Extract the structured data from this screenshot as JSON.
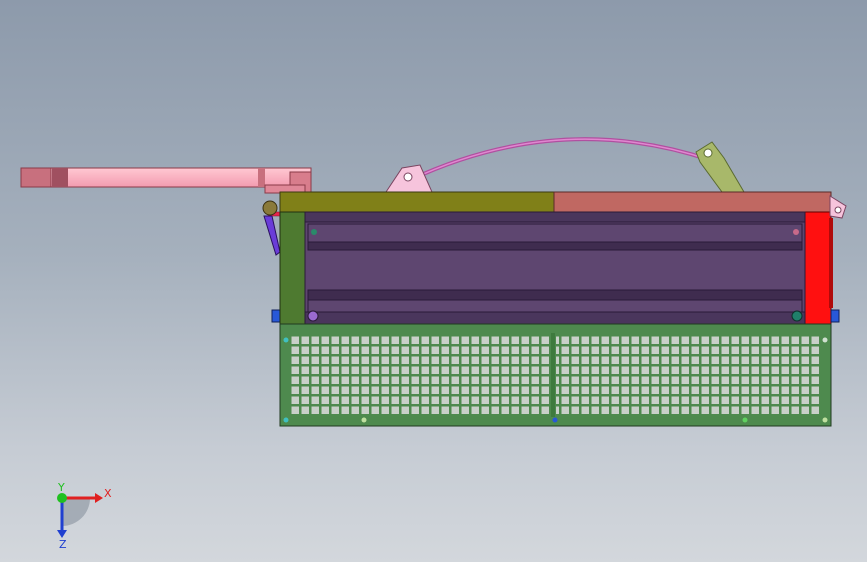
{
  "viewport": {
    "background_top": "#8d9aab",
    "background_bottom": "#d3d7dc"
  },
  "model": {
    "colors": {
      "handle": "#f7a8b8",
      "handle_dark": "#c06070",
      "top_left_plate": "#808018",
      "top_right_plate": "#c06862",
      "side_frame": "#4e7a30",
      "right_post": "#ff1010",
      "body_purple": "#5e4670",
      "rail_purple": "#3f2c4f",
      "arc_wire": "#c060b0",
      "bracket_pink": "#f6c4dc",
      "link_green": "#a8b86a",
      "grid_panel": "#4e8a4e",
      "grid_cell": "#c6cec6",
      "blue_tab": "#2858d8",
      "violet_side": "#6a3cd8"
    }
  },
  "triad": {
    "x_label": "X",
    "y_label": "Y",
    "z_label": "Z",
    "x_color": "#e02020",
    "y_color": "#20c020",
    "z_color": "#2040d0"
  }
}
